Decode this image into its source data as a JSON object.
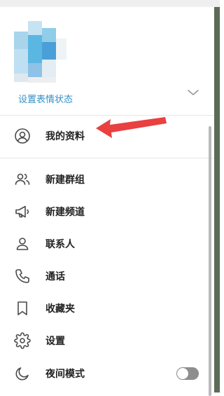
{
  "header": {
    "status_label": "设置表情状态"
  },
  "menu": {
    "my_profile": "我的资料",
    "new_group": "新建群组",
    "new_channel": "新建频道",
    "contacts": "联系人",
    "calls": "通话",
    "saved": "收藏夹",
    "settings": "设置",
    "night_mode": "夜间模式"
  },
  "night_mode_enabled": false,
  "colors": {
    "accent": "#3390c8",
    "annotation_arrow": "#e94040"
  }
}
